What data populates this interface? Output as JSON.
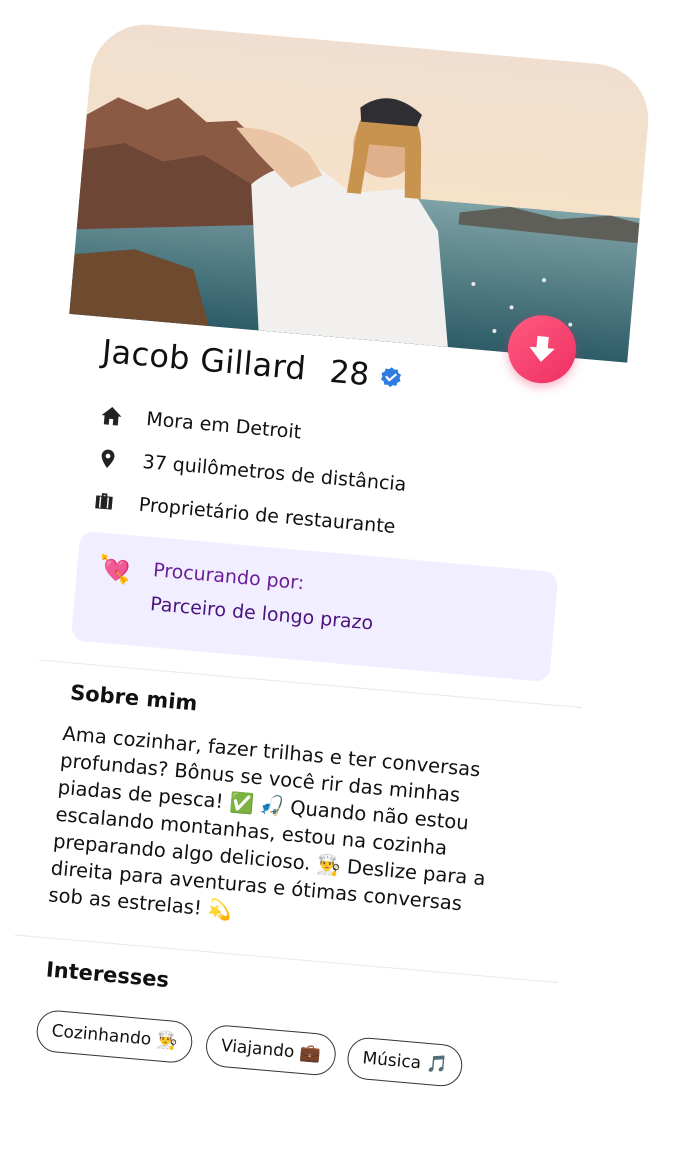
{
  "profile": {
    "name": "Jacob Gillard",
    "age": "28",
    "location": "Mora em Detroit",
    "distance": "37 quilômetros de distância",
    "job": "Proprietário de restaurante"
  },
  "looking_for": {
    "label": "Procurando por:",
    "value": "Parceiro de longo prazo",
    "emoji": "💘"
  },
  "about": {
    "title": "Sobre mim",
    "text": "Ama cozinhar, fazer trilhas e ter conversas profundas? Bônus se você rir das minhas piadas de pesca! ✅ 🎣 Quando não estou escalando montanhas, estou na cozinha preparando algo delicioso. 👨‍🍳 Deslize para a direita para aventuras e ótimas conversas sob as estrelas! 💫"
  },
  "interests": {
    "title": "Interesses",
    "tags": [
      "Cozinhando 👨‍🍳",
      "Viajando 💼",
      "Música 🎵"
    ]
  },
  "icons": {
    "home": "home-icon",
    "location": "location-pin-icon",
    "job": "briefcase-icon",
    "verified": "verified-badge-icon",
    "download": "arrow-down-icon"
  },
  "colors": {
    "accent": "#ef2f63",
    "verified": "#2f7de1",
    "looking_bg": "#f1efff",
    "looking_text": "#4b1280"
  }
}
